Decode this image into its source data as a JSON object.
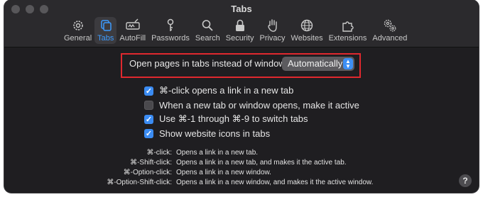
{
  "window": {
    "title": "Tabs"
  },
  "toolbar": {
    "tabs": [
      {
        "label": "General",
        "icon": "gear-icon"
      },
      {
        "label": "Tabs",
        "icon": "tabs-icon",
        "active": true
      },
      {
        "label": "AutoFill",
        "icon": "autofill-icon"
      },
      {
        "label": "Passwords",
        "icon": "key-icon"
      },
      {
        "label": "Search",
        "icon": "search-icon"
      },
      {
        "label": "Security",
        "icon": "lock-icon"
      },
      {
        "label": "Privacy",
        "icon": "hand-icon"
      },
      {
        "label": "Websites",
        "icon": "globe-icon"
      },
      {
        "label": "Extensions",
        "icon": "puzzle-icon"
      },
      {
        "label": "Advanced",
        "icon": "gears-icon"
      }
    ]
  },
  "settings": {
    "open_pages_label": "Open pages in tabs instead of windows:",
    "open_pages_value": "Automatically",
    "checkboxes": [
      {
        "label": "⌘-click opens a link in a new tab",
        "checked": true
      },
      {
        "label": "When a new tab or window opens, make it active",
        "checked": false
      },
      {
        "label": "Use ⌘-1 through ⌘-9 to switch tabs",
        "checked": true
      },
      {
        "label": "Show website icons in tabs",
        "checked": true
      }
    ]
  },
  "shortcuts": [
    {
      "key": "⌘-click:",
      "desc": "Opens a link in a new tab."
    },
    {
      "key": "⌘-Shift-click:",
      "desc": "Opens a link in a new tab, and makes it the active tab."
    },
    {
      "key": "⌘-Option-click:",
      "desc": "Opens a link in a new window."
    },
    {
      "key": "⌘-Option-Shift-click:",
      "desc": "Opens a link in a new window, and makes it the active window."
    }
  ],
  "help_button": "?",
  "colors": {
    "accent": "#3d9bff",
    "highlight_border": "#e0282e",
    "window_bg": "#1f1e21"
  }
}
